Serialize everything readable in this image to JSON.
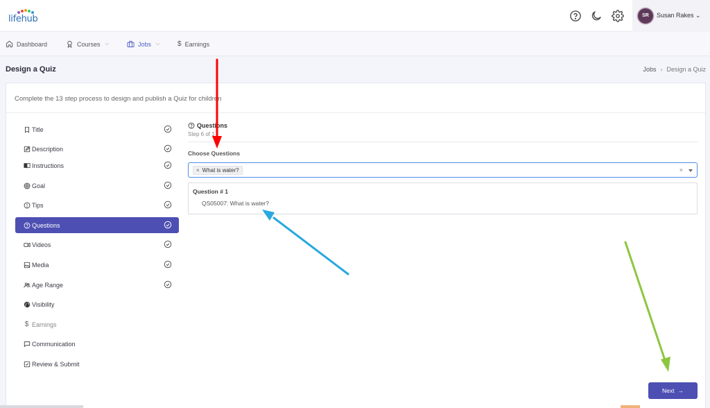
{
  "header": {
    "logo_text": "lifehub",
    "user_initials": "SR",
    "user_name": "Susan Rakes",
    "user_caret": "⌄"
  },
  "nav": {
    "items": [
      {
        "label": "Dashboard",
        "icon": "home-icon"
      },
      {
        "label": "Courses",
        "icon": "award-icon",
        "caret": true
      },
      {
        "label": "Jobs",
        "icon": "briefcase-icon",
        "caret": true,
        "active": true
      },
      {
        "label": "Earnings",
        "icon": "dollar-icon"
      }
    ]
  },
  "page": {
    "title": "Design a Quiz",
    "breadcrumb": [
      "Jobs",
      "Design a Quiz"
    ],
    "breadcrumb_sep": "›"
  },
  "intro": "Complete the 13 step process to design and publish a Quiz for children",
  "steps": [
    {
      "label": "Title",
      "icon": "bookmark-icon",
      "done": true
    },
    {
      "label": "Description",
      "icon": "edit-icon",
      "done": true
    },
    {
      "label": "Instructions",
      "icon": "book-icon",
      "done": true
    },
    {
      "label": "Goal",
      "icon": "target-icon",
      "done": true
    },
    {
      "label": "Tips",
      "icon": "alert-circle-icon",
      "done": true
    },
    {
      "label": "Questions",
      "icon": "help-circle-icon",
      "done": true,
      "active": true
    },
    {
      "label": "Videos",
      "icon": "video-icon",
      "done": true
    },
    {
      "label": "Media",
      "icon": "image-icon",
      "done": true
    },
    {
      "label": "Age Range",
      "icon": "users-icon",
      "done": true
    },
    {
      "label": "Visibility",
      "icon": "globe-icon",
      "done": false
    },
    {
      "label": "Earnings",
      "icon": "dollar-icon",
      "done": false,
      "muted": true
    },
    {
      "label": "Communication",
      "icon": "message-icon",
      "done": false
    },
    {
      "label": "Review & Submit",
      "icon": "check-square-icon",
      "done": false
    }
  ],
  "section": {
    "title": "Questions",
    "step_text": "Step 6 of 1",
    "field_label": "Choose Questions",
    "selected_tag": "What is water?",
    "tag_remove": "×",
    "clear": "×",
    "result_heading": "Question # 1",
    "result_item": "QS05007: What is water?"
  },
  "next_button": {
    "label": "Next",
    "arrow": "→"
  },
  "colors": {
    "accent": "#4d4fb3",
    "link_active": "#4f5fc4",
    "focus_border": "#4b8ee6",
    "arrow_red": "#ff0000",
    "arrow_blue": "#29a8e0",
    "arrow_green": "#8cc63f"
  }
}
